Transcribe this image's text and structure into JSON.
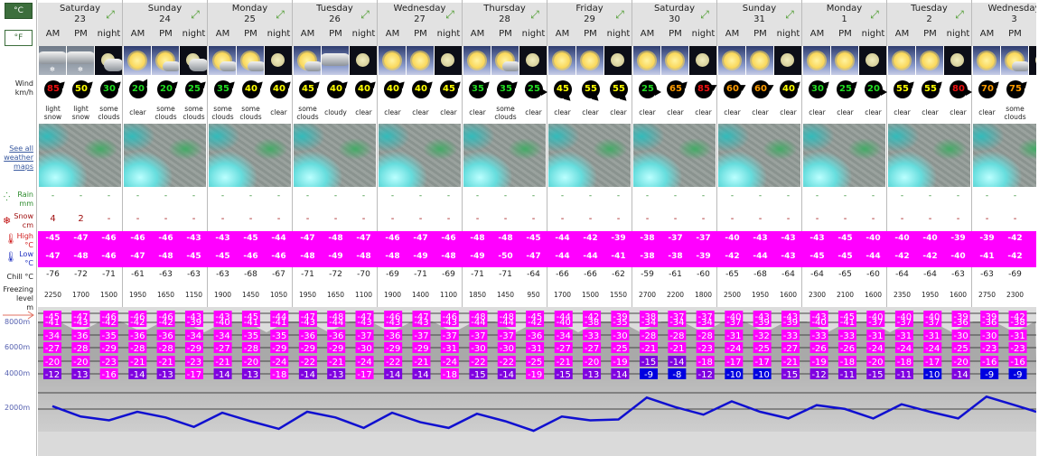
{
  "units": {
    "celsius": "°C",
    "fahrenheit": "°F"
  },
  "labels": {
    "wind": "Wind",
    "wind_unit": "km/h",
    "maps_link": "See all weather maps",
    "rain": "Rain",
    "rain_unit": "mm",
    "snow": "Snow",
    "snow_unit": "cm",
    "high": "High",
    "high_unit": "°C",
    "low": "Low",
    "low_unit": "°C",
    "chill": "Chill °C",
    "freezing": "Freezing level",
    "freezing_unit": "m"
  },
  "wind_colors": {
    "green": "#22dd22",
    "yellow": "#ffff00",
    "orange": "#ff9c00",
    "red": "#ee1111"
  },
  "temp_colors": {
    "magenta": "#ff00ff",
    "purple": "#8000e0",
    "blue": "#0000e0"
  },
  "altitude_axis": [
    "8000m",
    "6000m",
    "4000m",
    "2000m"
  ],
  "days": [
    {
      "name": "Saturday",
      "date": "23",
      "periods": [
        {
          "label": "AM",
          "icon": "light-snow",
          "wind": "85",
          "wind_dir": 45,
          "desc": "light snow",
          "rain": "-",
          "snow": "4",
          "high": "-45",
          "low": "-47",
          "chill": "-76",
          "freezing": "2250"
        },
        {
          "label": "PM",
          "icon": "light-snow",
          "wind": "50",
          "wind_dir": 45,
          "desc": "light snow",
          "rain": "-",
          "snow": "2",
          "high": "-47",
          "low": "-48",
          "chill": "-72",
          "freezing": "1700"
        },
        {
          "label": "night",
          "icon": "night-clouds",
          "wind": "30",
          "wind_dir": 45,
          "desc": "some clouds",
          "rain": "-",
          "snow": "-",
          "high": "-46",
          "low": "-46",
          "chill": "-71",
          "freezing": "1500"
        }
      ]
    },
    {
      "name": "Sunday",
      "date": "24",
      "periods": [
        {
          "label": "AM",
          "icon": "sun",
          "wind": "20",
          "wind_dir": 30,
          "desc": "clear",
          "rain": "-",
          "snow": "-",
          "high": "-46",
          "low": "-47",
          "chill": "-61",
          "freezing": "1950"
        },
        {
          "label": "PM",
          "icon": "sun-cloud",
          "wind": "20",
          "wind_dir": 45,
          "desc": "some clouds",
          "rain": "-",
          "snow": "-",
          "high": "-46",
          "low": "-48",
          "chill": "-63",
          "freezing": "1650"
        },
        {
          "label": "night",
          "icon": "night-clouds",
          "wind": "25",
          "wind_dir": 45,
          "desc": "some clouds",
          "rain": "-",
          "snow": "-",
          "high": "-43",
          "low": "-45",
          "chill": "-63",
          "freezing": "1150"
        }
      ]
    },
    {
      "name": "Monday",
      "date": "25",
      "periods": [
        {
          "label": "AM",
          "icon": "sun-cloud",
          "wind": "35",
          "wind_dir": 45,
          "desc": "some clouds",
          "rain": "-",
          "snow": "-",
          "high": "-43",
          "low": "-45",
          "chill": "-63",
          "freezing": "1900"
        },
        {
          "label": "PM",
          "icon": "sun-cloud",
          "wind": "40",
          "wind_dir": 45,
          "desc": "some clouds",
          "rain": "-",
          "snow": "-",
          "high": "-45",
          "low": "-46",
          "chill": "-68",
          "freezing": "1450"
        },
        {
          "label": "night",
          "icon": "moon",
          "wind": "40",
          "wind_dir": 45,
          "desc": "clear",
          "rain": "-",
          "snow": "-",
          "high": "-44",
          "low": "-46",
          "chill": "-67",
          "freezing": "1050"
        }
      ]
    },
    {
      "name": "Tuesday",
      "date": "26",
      "periods": [
        {
          "label": "AM",
          "icon": "sun-cloud",
          "wind": "45",
          "wind_dir": 45,
          "desc": "some clouds",
          "rain": "-",
          "snow": "-",
          "high": "-47",
          "low": "-48",
          "chill": "-71",
          "freezing": "1950"
        },
        {
          "label": "PM",
          "icon": "cloudy",
          "wind": "40",
          "wind_dir": 45,
          "desc": "cloudy",
          "rain": "-",
          "snow": "-",
          "high": "-48",
          "low": "-49",
          "chill": "-72",
          "freezing": "1650"
        },
        {
          "label": "night",
          "icon": "moon",
          "wind": "40",
          "wind_dir": 45,
          "desc": "clear",
          "rain": "-",
          "snow": "-",
          "high": "-47",
          "low": "-48",
          "chill": "-70",
          "freezing": "1100"
        }
      ]
    },
    {
      "name": "Wednesday",
      "date": "27",
      "periods": [
        {
          "label": "AM",
          "icon": "sun",
          "wind": "40",
          "wind_dir": 45,
          "desc": "clear",
          "rain": "-",
          "snow": "-",
          "high": "-46",
          "low": "-48",
          "chill": "-69",
          "freezing": "1900"
        },
        {
          "label": "PM",
          "icon": "sun",
          "wind": "40",
          "wind_dir": 45,
          "desc": "clear",
          "rain": "-",
          "snow": "-",
          "high": "-47",
          "low": "-49",
          "chill": "-71",
          "freezing": "1400"
        },
        {
          "label": "night",
          "icon": "moon",
          "wind": "45",
          "wind_dir": 45,
          "desc": "clear",
          "rain": "-",
          "snow": "-",
          "high": "-46",
          "low": "-48",
          "chill": "-69",
          "freezing": "1100"
        }
      ]
    },
    {
      "name": "Thursday",
      "date": "28",
      "periods": [
        {
          "label": "AM",
          "icon": "sun",
          "wind": "35",
          "wind_dir": 45,
          "desc": "clear",
          "rain": "-",
          "snow": "-",
          "high": "-48",
          "low": "-49",
          "chill": "-71",
          "freezing": "1850"
        },
        {
          "label": "PM",
          "icon": "sun-cloud",
          "wind": "35",
          "wind_dir": 45,
          "desc": "some clouds",
          "rain": "-",
          "snow": "-",
          "high": "-48",
          "low": "-50",
          "chill": "-71",
          "freezing": "1450"
        },
        {
          "label": "night",
          "icon": "moon",
          "wind": "25",
          "wind_dir": 90,
          "desc": "clear",
          "rain": "-",
          "snow": "-",
          "high": "-45",
          "low": "-47",
          "chill": "-64",
          "freezing": "950"
        }
      ]
    },
    {
      "name": "Friday",
      "date": "29",
      "periods": [
        {
          "label": "AM",
          "icon": "sun",
          "wind": "45",
          "wind_dir": 135,
          "desc": "clear",
          "rain": "-",
          "snow": "-",
          "high": "-44",
          "low": "-44",
          "chill": "-66",
          "freezing": "1700"
        },
        {
          "label": "PM",
          "icon": "sun",
          "wind": "55",
          "wind_dir": 135,
          "desc": "clear",
          "rain": "-",
          "snow": "-",
          "high": "-42",
          "low": "-44",
          "chill": "-66",
          "freezing": "1500"
        },
        {
          "label": "night",
          "icon": "moon",
          "wind": "55",
          "wind_dir": 135,
          "desc": "clear",
          "rain": "-",
          "snow": "-",
          "high": "-39",
          "low": "-41",
          "chill": "-62",
          "freezing": "1550"
        }
      ]
    },
    {
      "name": "Saturday",
      "date": "30",
      "periods": [
        {
          "label": "AM",
          "icon": "sun",
          "wind": "25",
          "wind_dir": 90,
          "desc": "clear",
          "rain": "-",
          "snow": "-",
          "high": "-38",
          "low": "-38",
          "chill": "-59",
          "freezing": "2700"
        },
        {
          "label": "PM",
          "icon": "sun",
          "wind": "65",
          "wind_dir": 45,
          "desc": "clear",
          "rain": "-",
          "snow": "-",
          "high": "-37",
          "low": "-38",
          "chill": "-61",
          "freezing": "2200"
        },
        {
          "label": "night",
          "icon": "moon",
          "wind": "85",
          "wind_dir": 60,
          "desc": "clear",
          "rain": "-",
          "snow": "-",
          "high": "-37",
          "low": "-39",
          "chill": "-60",
          "freezing": "1800"
        }
      ]
    },
    {
      "name": "Sunday",
      "date": "31",
      "periods": [
        {
          "label": "AM",
          "icon": "sun",
          "wind": "60",
          "wind_dir": 60,
          "desc": "clear",
          "rain": "-",
          "snow": "-",
          "high": "-40",
          "low": "-42",
          "chill": "-65",
          "freezing": "2500"
        },
        {
          "label": "PM",
          "icon": "sun",
          "wind": "60",
          "wind_dir": 60,
          "desc": "clear",
          "rain": "-",
          "snow": "-",
          "high": "-43",
          "low": "-44",
          "chill": "-68",
          "freezing": "1950"
        },
        {
          "label": "night",
          "icon": "moon",
          "wind": "40",
          "wind_dir": 45,
          "desc": "clear",
          "rain": "-",
          "snow": "-",
          "high": "-43",
          "low": "-43",
          "chill": "-64",
          "freezing": "1600"
        }
      ]
    },
    {
      "name": "Monday",
      "date": "1",
      "periods": [
        {
          "label": "AM",
          "icon": "sun",
          "wind": "30",
          "wind_dir": 45,
          "desc": "clear",
          "rain": "-",
          "snow": "-",
          "high": "-43",
          "low": "-45",
          "chill": "-64",
          "freezing": "2300"
        },
        {
          "label": "PM",
          "icon": "sun",
          "wind": "25",
          "wind_dir": 45,
          "desc": "clear",
          "rain": "-",
          "snow": "-",
          "high": "-45",
          "low": "-45",
          "chill": "-65",
          "freezing": "2100"
        },
        {
          "label": "night",
          "icon": "moon",
          "wind": "20",
          "wind_dir": 90,
          "desc": "clear",
          "rain": "-",
          "snow": "-",
          "high": "-40",
          "low": "-44",
          "chill": "-60",
          "freezing": "1600"
        }
      ]
    },
    {
      "name": "Tuesday",
      "date": "2",
      "periods": [
        {
          "label": "AM",
          "icon": "sun",
          "wind": "55",
          "wind_dir": 45,
          "desc": "clear",
          "rain": "-",
          "snow": "-",
          "high": "-40",
          "low": "-42",
          "chill": "-64",
          "freezing": "2350"
        },
        {
          "label": "PM",
          "icon": "sun",
          "wind": "55",
          "wind_dir": 45,
          "desc": "clear",
          "rain": "-",
          "snow": "-",
          "high": "-40",
          "low": "-42",
          "chill": "-64",
          "freezing": "1950"
        },
        {
          "label": "night",
          "icon": "moon",
          "wind": "80",
          "wind_dir": 90,
          "desc": "clear",
          "rain": "-",
          "snow": "-",
          "high": "-39",
          "low": "-40",
          "chill": "-63",
          "freezing": "1600"
        }
      ]
    },
    {
      "name": "Wednesday",
      "date": "3",
      "periods": [
        {
          "label": "AM",
          "icon": "sun",
          "wind": "70",
          "wind_dir": 45,
          "desc": "clear",
          "rain": "-",
          "snow": "-",
          "high": "-39",
          "low": "-41",
          "chill": "-63",
          "freezing": "2750"
        },
        {
          "label": "PM",
          "icon": "sun-cloud",
          "wind": "75",
          "wind_dir": 45,
          "desc": "some clouds",
          "rain": "-",
          "snow": "-",
          "high": "-42",
          "low": "-42",
          "chill": "-69",
          "freezing": "2300"
        },
        {
          "label": "ni",
          "icon": "night-clouds"
        }
      ]
    }
  ],
  "altitude_temps": [
    [
      -45,
      -41,
      -34,
      -27,
      -20,
      -12
    ],
    [
      -47,
      -43,
      -36,
      -28,
      -20,
      -13
    ],
    [
      -46,
      -42,
      -35,
      -29,
      -23,
      -16
    ],
    [
      -46,
      -42,
      -36,
      -28,
      -21,
      -14
    ],
    [
      -46,
      -42,
      -36,
      -28,
      -21,
      -13
    ],
    [
      -43,
      -39,
      -34,
      -29,
      -23,
      -17
    ],
    [
      -43,
      -40,
      -34,
      -27,
      -21,
      -14
    ],
    [
      -45,
      -41,
      -35,
      -28,
      -20,
      -13
    ],
    [
      -44,
      -41,
      -35,
      -29,
      -24,
      -18
    ],
    [
      -47,
      -43,
      -36,
      -29,
      -22,
      -14
    ],
    [
      -48,
      -44,
      -36,
      -29,
      -21,
      -13
    ],
    [
      -47,
      -43,
      -37,
      -30,
      -24,
      -17
    ],
    [
      -46,
      -43,
      -36,
      -29,
      -22,
      -14
    ],
    [
      -47,
      -43,
      -37,
      -29,
      -21,
      -14
    ],
    [
      -46,
      -43,
      -37,
      -31,
      -24,
      -18
    ],
    [
      -48,
      -44,
      -37,
      -30,
      -22,
      -15
    ],
    [
      -48,
      -44,
      -37,
      -30,
      -22,
      -14
    ],
    [
      -45,
      -42,
      -36,
      -31,
      -25,
      -19
    ],
    [
      -44,
      -40,
      -34,
      -27,
      -21,
      -15
    ],
    [
      -42,
      -38,
      -33,
      -27,
      -20,
      -13
    ],
    [
      -39,
      -35,
      -30,
      -25,
      -19,
      -14
    ],
    [
      -38,
      -34,
      -28,
      -21,
      -15,
      -9
    ],
    [
      -37,
      -34,
      -28,
      -21,
      -14,
      -8
    ],
    [
      -37,
      -34,
      -28,
      -23,
      -18,
      -12
    ],
    [
      -40,
      -37,
      -31,
      -24,
      -17,
      -10
    ],
    [
      -43,
      -39,
      -32,
      -25,
      -17,
      -10
    ],
    [
      -43,
      -39,
      -33,
      -27,
      -21,
      -15
    ],
    [
      -43,
      -40,
      -33,
      -26,
      -19,
      -12
    ],
    [
      -45,
      -41,
      -33,
      -26,
      -18,
      -11
    ],
    [
      -40,
      -37,
      -31,
      -24,
      -20,
      -15
    ],
    [
      -40,
      -37,
      -31,
      -24,
      -18,
      -11
    ],
    [
      -40,
      -37,
      -31,
      -24,
      -17,
      -10
    ],
    [
      -39,
      -36,
      -30,
      -25,
      -20,
      -14
    ],
    [
      -39,
      -36,
      -30,
      -23,
      -16,
      -9
    ],
    [
      -42,
      -38,
      -31,
      -23,
      -16,
      -9
    ]
  ]
}
